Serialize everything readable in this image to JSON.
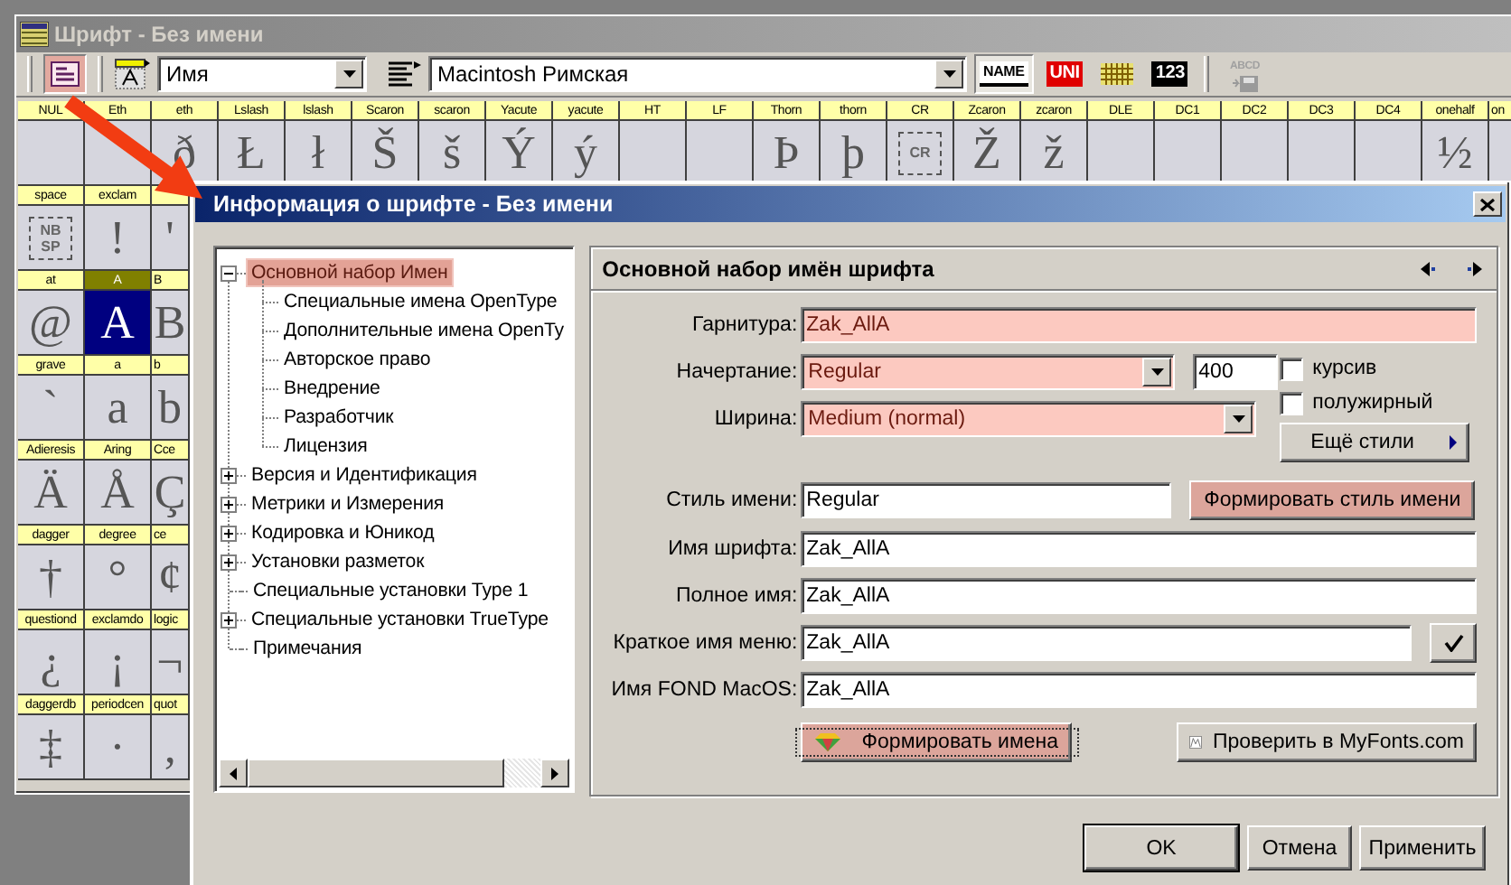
{
  "main_window": {
    "title": "Шрифт - Без имени",
    "toolbar": {
      "info_button": {
        "selected": true
      },
      "caption_select": {
        "value": "Имя"
      },
      "encoding_select": {
        "value": "Macintosh Римская"
      },
      "view_buttons": [
        {
          "kind": "name",
          "text": "NAME",
          "selected": true
        },
        {
          "kind": "unicode",
          "text": "UNI",
          "selected": false
        },
        {
          "kind": "grid",
          "selected": false
        },
        {
          "kind": "number",
          "text": "123",
          "selected": false
        }
      ],
      "export_button": {
        "text": "ABCD",
        "disabled": true
      }
    },
    "glyph_grid": {
      "rows": [
        {
          "cells": [
            {
              "label": "NUL",
              "selected": false
            },
            {
              "label": "Eth",
              "selected": false
            },
            {
              "label": "eth",
              "glyph": "ð",
              "selected": false
            },
            {
              "label": "Lslash",
              "glyph": "Ł",
              "selected": false
            },
            {
              "label": "lslash",
              "glyph": "ł",
              "selected": false
            },
            {
              "label": "Scaron",
              "glyph": "Š",
              "selected": false
            },
            {
              "label": "scaron",
              "glyph": "š",
              "selected": false
            },
            {
              "label": "Yacute",
              "glyph": "Ý",
              "selected": false
            },
            {
              "label": "yacute",
              "glyph": "ý",
              "selected": false
            },
            {
              "label": "HT",
              "selected": false
            },
            {
              "label": "LF",
              "selected": false
            },
            {
              "label": "Thorn",
              "glyph": "Þ",
              "selected": false
            },
            {
              "label": "thorn",
              "glyph": "þ",
              "selected": false
            },
            {
              "label": "CR",
              "glyph": "CR",
              "kind": "box",
              "selected": false
            },
            {
              "label": "Zcaron",
              "glyph": "Ž",
              "selected": false
            },
            {
              "label": "zcaron",
              "glyph": "ž",
              "selected": false
            },
            {
              "label": "DLE",
              "selected": false
            },
            {
              "label": "DC1",
              "selected": false
            },
            {
              "label": "DC2",
              "selected": false
            },
            {
              "label": "DC3",
              "selected": false
            },
            {
              "label": "DC4",
              "selected": false
            },
            {
              "label": "onehalf",
              "glyph": "½",
              "selected": false
            },
            {
              "label": "on",
              "selected": false
            }
          ]
        },
        {
          "cells": [
            {
              "label": "space",
              "glyph": "NB SP",
              "kind": "box",
              "selected": false
            },
            {
              "label": "exclam",
              "glyph": "!",
              "selected": false
            },
            {
              "glyph": "'",
              "selected": false
            }
          ]
        },
        {
          "cells": [
            {
              "label": "at",
              "glyph": "@",
              "selected": false
            },
            {
              "label": "A",
              "glyph": "A",
              "selected": true
            },
            {
              "label": "B",
              "glyph": "B",
              "selected": false
            }
          ]
        },
        {
          "cells": [
            {
              "label": "grave",
              "glyph": "`",
              "selected": false
            },
            {
              "label": "a",
              "glyph": "a",
              "selected": false
            },
            {
              "label": "b",
              "glyph": "b",
              "selected": false
            }
          ]
        },
        {
          "cells": [
            {
              "label": "Adieresis",
              "glyph": "Ä",
              "selected": false
            },
            {
              "label": "Aring",
              "glyph": "Å",
              "selected": false
            },
            {
              "label": "Cce",
              "glyph": "Ç",
              "selected": false
            }
          ]
        },
        {
          "cells": [
            {
              "label": "dagger",
              "glyph": "†",
              "selected": false
            },
            {
              "label": "degree",
              "glyph": "°",
              "selected": false
            },
            {
              "label": "ce",
              "glyph": "¢",
              "selected": false
            }
          ]
        },
        {
          "cells": [
            {
              "label": "questiond",
              "glyph": "¿",
              "selected": false
            },
            {
              "label": "exclamdo",
              "glyph": "¡",
              "selected": false
            },
            {
              "label": "logic",
              "glyph": "¬",
              "selected": false
            }
          ]
        },
        {
          "cells": [
            {
              "label": "daggerdb",
              "glyph": "‡",
              "selected": false
            },
            {
              "label": "periodcen",
              "glyph": "·",
              "selected": false
            },
            {
              "label": "quot",
              "glyph": "‚",
              "selected": false
            }
          ]
        }
      ]
    }
  },
  "dialog": {
    "title": "Информация о шрифте - Без имени",
    "tree": {
      "items": [
        {
          "label": "Основной набор Имен",
          "kind": "branch",
          "expanded": true,
          "selected": true,
          "children": [
            {
              "label": "Специальные имена OpenType",
              "selected": false
            },
            {
              "label": "Дополнительные имена OpenTy",
              "selected": false
            },
            {
              "label": "Авторское право",
              "selected": false
            },
            {
              "label": "Внедрение",
              "selected": false
            },
            {
              "label": "Разработчик",
              "selected": false
            },
            {
              "label": "Лицензия",
              "selected": false
            }
          ]
        },
        {
          "label": "Версия и Идентификация",
          "kind": "branch",
          "expanded": false,
          "selected": false
        },
        {
          "label": "Метрики и Измерения",
          "kind": "branch",
          "expanded": false,
          "selected": false
        },
        {
          "label": "Кодировка и Юникод",
          "kind": "branch",
          "expanded": false,
          "selected": false
        },
        {
          "label": "Установки разметок",
          "kind": "branch",
          "expanded": false,
          "selected": false
        },
        {
          "label": "Специальные установки Type 1",
          "kind": "leaf",
          "selected": false
        },
        {
          "label": "Специальные установки TrueType",
          "kind": "branch",
          "expanded": false,
          "selected": false
        },
        {
          "label": "Примечания",
          "kind": "leaf",
          "selected": false
        }
      ]
    },
    "panel": {
      "title": "Основной набор имён шрифта",
      "family": {
        "label": "Гарнитура:",
        "value": "Zak_AllA",
        "highlighted": true
      },
      "style": {
        "label": "Начертание:",
        "value": "Regular",
        "highlighted": true,
        "weight": "400"
      },
      "width": {
        "label": "Ширина:",
        "value": "Medium (normal)",
        "highlighted": true
      },
      "options": [
        {
          "label": "курсив",
          "checked": false
        },
        {
          "label": "полужирный",
          "checked": false
        }
      ],
      "more_styles_button": "Ещё стили",
      "style_name": {
        "label": "Стиль имени:",
        "value": "Regular",
        "highlighted": false
      },
      "build_style_button": {
        "label": "Формировать стиль имени",
        "highlighted": true
      },
      "names": [
        {
          "label": "Имя шрифта:",
          "value": "Zak_AllA",
          "kind": "plain",
          "highlighted": false
        },
        {
          "label": "Полное имя:",
          "value": "Zak_AllA",
          "kind": "plain",
          "highlighted": false
        },
        {
          "label": "Краткое имя меню:",
          "value": "Zak_AllA",
          "kind": "with-check",
          "highlighted": false
        },
        {
          "label": "Имя FOND MacOS:",
          "value": "Zak_AllA",
          "kind": "plain",
          "highlighted": false
        }
      ],
      "build_names_button": {
        "label": "Формировать имена",
        "highlighted": true
      },
      "myfonts_button": "Проверить в MyFonts.com"
    },
    "buttons": [
      {
        "label": "OK",
        "default": true
      },
      {
        "label": "Отмена",
        "default": false
      },
      {
        "label": "Применить",
        "default": false
      }
    ]
  }
}
